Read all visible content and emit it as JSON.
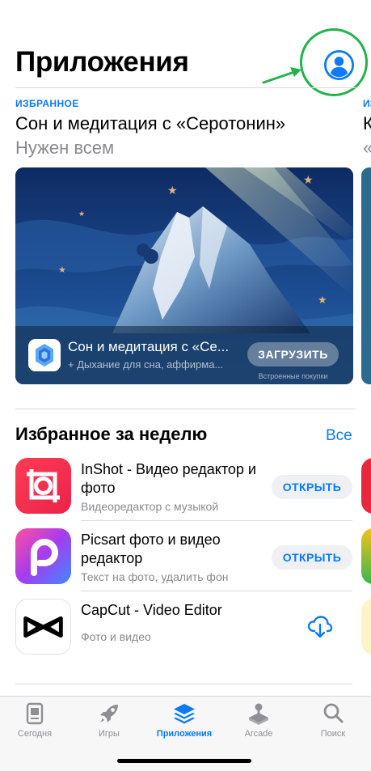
{
  "header": {
    "title": "Приложения",
    "account_icon": "person-circle-icon",
    "annotation_color": "#22b34a"
  },
  "featured": {
    "tag": "ИЗБРАННОЕ",
    "title": "Сон и медитация с «Серотонин»",
    "subtitle": "Нужен всем",
    "card": {
      "app_title": "Сон и медитация с «Се...",
      "app_subtitle": "+ Дыхание для сна, аффирма...",
      "get_label": "ЗАГРУЗИТЬ",
      "iap_note": "Встроенные покупки"
    },
    "peek": {
      "tag": "ИЗБ",
      "title": "К",
      "subtitle": "«"
    }
  },
  "weekly": {
    "title": "Избранное за неделю",
    "see_all": "Все",
    "apps": [
      {
        "name": "InShot - Видео редактор и фото",
        "subtitle": "Видеоредактор с музыкой",
        "action": "ОТКРЫТЬ"
      },
      {
        "name": "Picsart фото и видео редактор",
        "subtitle": "Текст на фото, удалить фон",
        "action": "ОТКРЫТЬ"
      },
      {
        "name": "CapCut - Video Editor",
        "subtitle": "Фото и видео",
        "action_icon": "cloud-download-icon"
      }
    ]
  },
  "tabbar": {
    "tabs": [
      {
        "label": "Сегодня",
        "icon": "today-icon"
      },
      {
        "label": "Игры",
        "icon": "rocket-icon"
      },
      {
        "label": "Приложения",
        "icon": "apps-stack-icon",
        "active": true
      },
      {
        "label": "Arcade",
        "icon": "joystick-icon"
      },
      {
        "label": "Поиск",
        "icon": "search-icon"
      }
    ]
  },
  "colors": {
    "accent": "#0a7aff",
    "secondary_text": "#8a8a8e",
    "tab_inactive": "#8e8e93"
  }
}
